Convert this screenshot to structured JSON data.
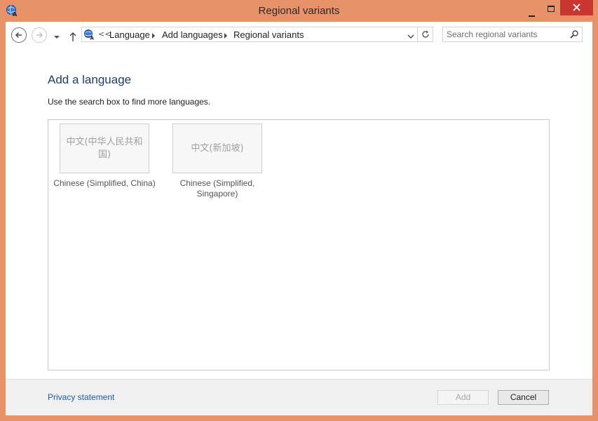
{
  "window": {
    "title": "Regional variants",
    "accent_color": "#e8926a",
    "close_color": "#c7372f",
    "controls": [
      "minimize-icon",
      "maximize-icon",
      "close-icon"
    ]
  },
  "navigation": {
    "overflow_marker": "<<",
    "breadcrumbs": [
      "Language",
      "Add languages",
      "Regional variants"
    ],
    "search": {
      "value": "",
      "placeholder": "Search regional variants"
    }
  },
  "main": {
    "heading": "Add a language",
    "instruction": "Use the search box to find more languages.",
    "languages": [
      {
        "native": "中文(中华人民共和国)",
        "label": "Chinese (Simplified, China)"
      },
      {
        "native": "中文(新加坡)",
        "label": "Chinese (Simplified, Singapore)"
      }
    ]
  },
  "footer": {
    "privacy_link": "Privacy statement",
    "add_label": "Add",
    "cancel_label": "Cancel"
  }
}
